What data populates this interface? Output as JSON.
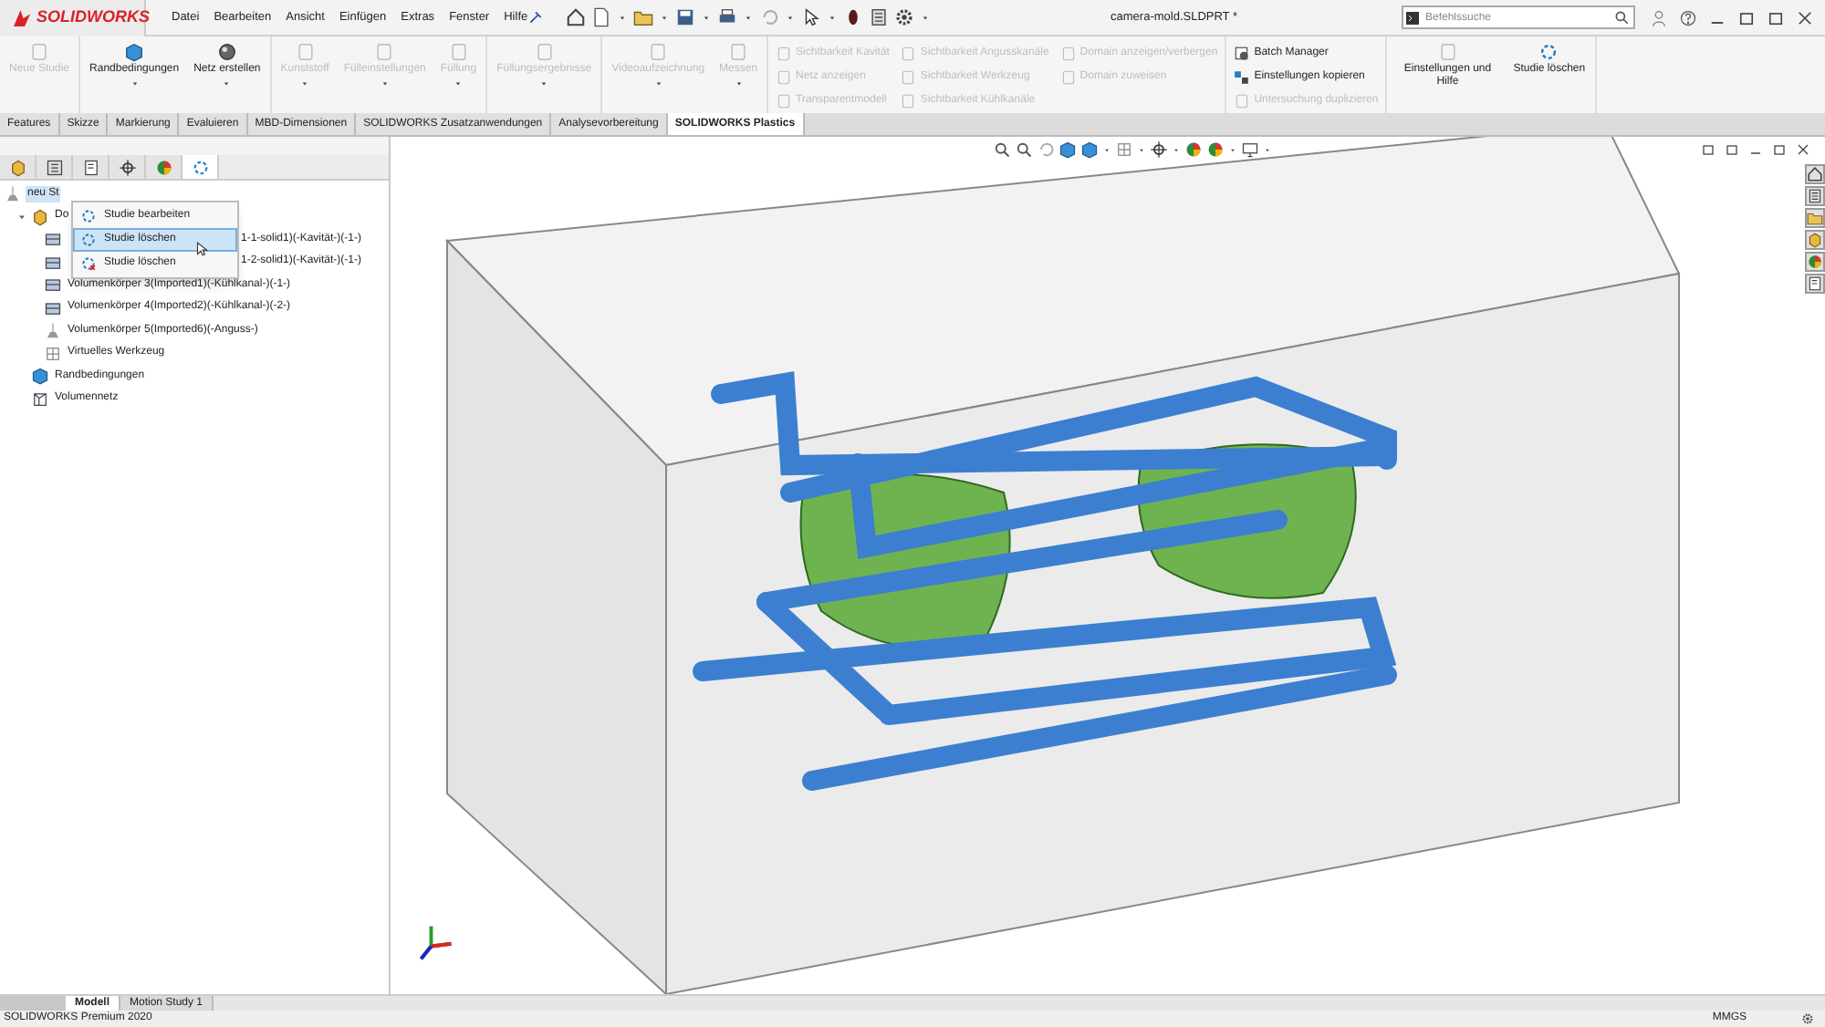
{
  "title_bar": {
    "logo": "SOLIDWORKS",
    "menu": [
      "Datei",
      "Bearbeiten",
      "Ansicht",
      "Einfügen",
      "Extras",
      "Fenster",
      "Hilfe"
    ],
    "document_title": "camera-mold.SLDPRT *",
    "search": {
      "placeholder": "Befehlssuche"
    }
  },
  "ribbon": {
    "groups": [
      {
        "buttons": [
          {
            "label": "Neue Studie",
            "kind": "large",
            "disabled": true
          }
        ]
      },
      {
        "buttons": [
          {
            "label": "Randbedingungen",
            "kind": "large",
            "disabled": false
          },
          {
            "label": "Netz erstellen",
            "kind": "large",
            "disabled": false
          }
        ]
      },
      {
        "buttons": [
          {
            "label": "Kunststoff",
            "kind": "large",
            "disabled": true
          },
          {
            "label": "Fülleinstellungen",
            "kind": "large",
            "disabled": true
          },
          {
            "label": "Füllung",
            "kind": "large",
            "disabled": true
          }
        ]
      },
      {
        "buttons": [
          {
            "label": "Füllungsergebnisse",
            "kind": "large",
            "disabled": true
          }
        ]
      },
      {
        "buttons": [
          {
            "label": "Videoaufzeichnung",
            "kind": "large",
            "disabled": true
          },
          {
            "label": "Messen",
            "kind": "large",
            "disabled": true
          }
        ]
      },
      {
        "buttons": [
          {
            "label": "Sichtbarkeit Kavität",
            "kind": "small",
            "disabled": true
          },
          {
            "label": "Netz anzeigen",
            "kind": "small",
            "disabled": true
          },
          {
            "label": "Transparentmodell",
            "kind": "small",
            "disabled": true
          },
          {
            "label": "Sichtbarkeit Angusskanäle",
            "kind": "small",
            "disabled": true
          },
          {
            "label": "Sichtbarkeit Werkzeug",
            "kind": "small",
            "disabled": true
          },
          {
            "label": "Sichtbarkeit Kühlkanäle",
            "kind": "small",
            "disabled": true
          },
          {
            "label": "Domain anzeigen/verbergen",
            "kind": "small",
            "disabled": true
          },
          {
            "label": "Domain zuweisen",
            "kind": "small",
            "disabled": true
          }
        ]
      },
      {
        "buttons": [
          {
            "label": "Batch Manager",
            "kind": "small",
            "disabled": false
          },
          {
            "label": "Einstellungen kopieren",
            "kind": "small",
            "disabled": false
          },
          {
            "label": "Untersuchung duplizieren",
            "kind": "small",
            "disabled": true
          }
        ]
      },
      {
        "buttons": [
          {
            "label": "Einstellungen und Hilfe",
            "kind": "large",
            "disabled": false
          },
          {
            "label": "Studie löschen",
            "kind": "large",
            "disabled": false
          }
        ]
      }
    ]
  },
  "command_tabs": [
    {
      "label": "Features",
      "selected": false
    },
    {
      "label": "Skizze",
      "selected": false
    },
    {
      "label": "Markierung",
      "selected": false
    },
    {
      "label": "Evaluieren",
      "selected": false
    },
    {
      "label": "MBD-Dimensionen",
      "selected": false
    },
    {
      "label": "SOLIDWORKS Zusatzanwendungen",
      "selected": false
    },
    {
      "label": "Analysevorbereitung",
      "selected": false
    },
    {
      "label": "SOLIDWORKS Plastics",
      "selected": true
    }
  ],
  "manager_tabs": [
    {
      "selected": false
    },
    {
      "selected": false
    },
    {
      "selected": false
    },
    {
      "selected": false
    },
    {
      "selected": false
    },
    {
      "selected": true
    }
  ],
  "tree": [
    {
      "label": "neu St",
      "selected": true,
      "children": [
        {
          "label": "Do",
          "selected": false,
          "expanded": true,
          "children": [
            {
              "label": "1-1-solid1)(-Kavität-)(-1-)",
              "selected": false
            },
            {
              "label": "1-2-solid1)(-Kavität-)(-1-)",
              "selected": false
            },
            {
              "label": "Volumenkörper 3(Imported1)(-Kühlkanal-)(-1-)",
              "selected": false
            },
            {
              "label": "Volumenkörper 4(Imported2)(-Kühlkanal-)(-2-)",
              "selected": false
            },
            {
              "label": "Volumenkörper 5(Imported6)(-Anguss-)",
              "selected": false
            },
            {
              "label": "Virtuelles Werkzeug",
              "selected": false
            }
          ]
        },
        {
          "label": "Randbedingungen",
          "selected": false
        },
        {
          "label": "Volumennetz",
          "selected": false
        }
      ]
    }
  ],
  "context_menu": [
    {
      "label": "Studie bearbeiten",
      "selected": false
    },
    {
      "label": "Studie löschen",
      "selected": true
    },
    {
      "label": "Studie löschen",
      "selected": false
    }
  ],
  "bottom_tabs": [
    {
      "label": "Modell",
      "selected": true
    },
    {
      "label": "Motion Study 1",
      "selected": false
    }
  ],
  "status_bar": {
    "product": "SOLIDWORKS Premium 2020",
    "units": "MMGS"
  }
}
